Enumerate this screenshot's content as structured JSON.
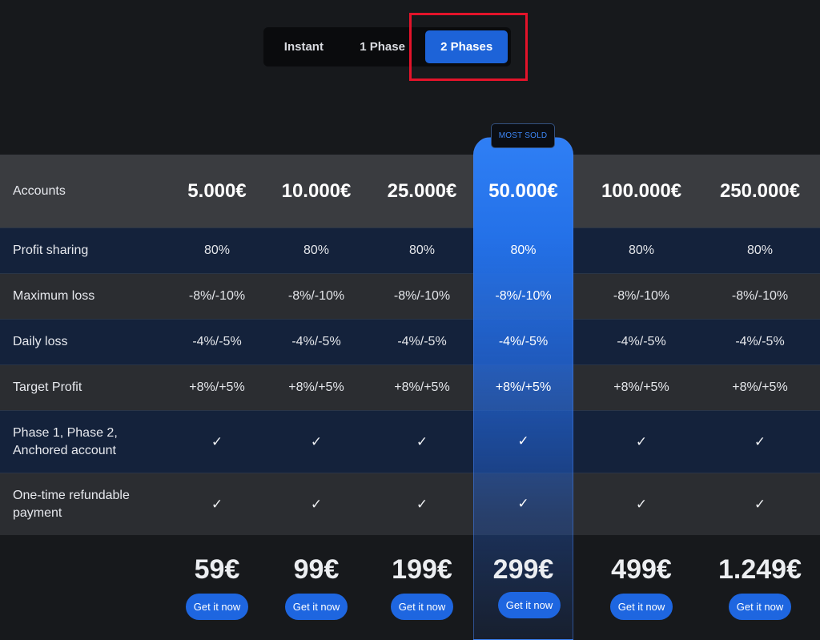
{
  "tabs": [
    {
      "label": "Instant",
      "active": false
    },
    {
      "label": "1 Phase",
      "active": false
    },
    {
      "label": "2 Phases",
      "active": true
    }
  ],
  "badge": "MOST SOLD",
  "colors": {
    "accent": "#1d63d8",
    "highlight_border": "#e3132a",
    "background": "#17191c"
  },
  "table": {
    "accounts_label": "Accounts",
    "accounts": [
      "5.000€",
      "10.000€",
      "25.000€",
      "50.000€",
      "100.000€",
      "250.000€"
    ],
    "rows": [
      {
        "label": "Profit sharing",
        "values": [
          "80%",
          "80%",
          "80%",
          "80%",
          "80%",
          "80%"
        ]
      },
      {
        "label": "Maximum loss",
        "values": [
          "-8%/-10%",
          "-8%/-10%",
          "-8%/-10%",
          "-8%/-10%",
          "-8%/-10%",
          "-8%/-10%"
        ]
      },
      {
        "label": "Daily loss",
        "values": [
          "-4%/-5%",
          "-4%/-5%",
          "-4%/-5%",
          "-4%/-5%",
          "-4%/-5%",
          "-4%/-5%"
        ]
      },
      {
        "label": "Target Profit",
        "values": [
          "+8%/+5%",
          "+8%/+5%",
          "+8%/+5%",
          "+8%/+5%",
          "+8%/+5%",
          "+8%/+5%"
        ]
      },
      {
        "label_line1": "Phase 1, Phase 2,",
        "label_line2": "Anchored account",
        "values": [
          "✓",
          "✓",
          "✓",
          "✓",
          "✓",
          "✓"
        ]
      },
      {
        "label_line1": "One-time refundable",
        "label_line2": "payment",
        "values": [
          "✓",
          "✓",
          "✓",
          "✓",
          "✓",
          "✓"
        ]
      }
    ],
    "prices": [
      "59€",
      "99€",
      "199€",
      "299€",
      "499€",
      "1.249€"
    ],
    "button_label": "Get it now"
  }
}
